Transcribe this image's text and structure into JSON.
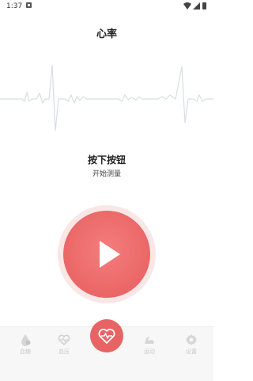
{
  "status_bar": {
    "time": "1:37"
  },
  "header": {
    "title": "心率"
  },
  "instruction": {
    "main": "按下按钮",
    "sub": "开始测量"
  },
  "play_button": {
    "icon": "play-icon"
  },
  "bottom_nav": {
    "items": [
      {
        "label": "血糖",
        "icon": "blood-drop-icon"
      },
      {
        "label": "血压",
        "icon": "heart-outline-icon"
      },
      {
        "label": "",
        "icon": "heart-rate-icon"
      },
      {
        "label": "运动",
        "icon": "bicep-icon"
      },
      {
        "label": "设置",
        "icon": "gear-icon"
      }
    ]
  },
  "colors": {
    "accent": "#e86363",
    "halo": "#f9e7e7",
    "ecg_line": "#d8dde3",
    "nav_icon": "#c9c9c9"
  }
}
